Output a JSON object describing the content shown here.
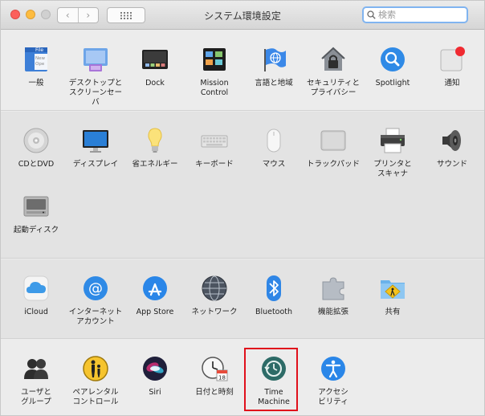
{
  "window": {
    "title": "システム環境設定"
  },
  "toolbar": {
    "back": "‹",
    "forward": "›"
  },
  "search": {
    "placeholder": "検索"
  },
  "sections": [
    [
      {
        "name": "general",
        "label": "一般",
        "icon": "general-icon"
      },
      {
        "name": "desktop-screensaver",
        "label": "デスクトップと\nスクリーンセーバ",
        "icon": "desktop-icon"
      },
      {
        "name": "dock",
        "label": "Dock",
        "icon": "dock-icon"
      },
      {
        "name": "mission-control",
        "label": "Mission\nControl",
        "icon": "mission-control-icon"
      },
      {
        "name": "language-region",
        "label": "言語と地域",
        "icon": "flag-globe-icon"
      },
      {
        "name": "security-privacy",
        "label": "セキュリティと\nプライバシー",
        "icon": "house-lock-icon"
      },
      {
        "name": "spotlight",
        "label": "Spotlight",
        "icon": "magnifier-icon"
      },
      {
        "name": "notifications",
        "label": "通知",
        "icon": "notifications-icon"
      }
    ],
    [
      {
        "name": "cd-dvd",
        "label": "CDとDVD",
        "icon": "disc-icon"
      },
      {
        "name": "displays",
        "label": "ディスプレイ",
        "icon": "monitor-icon"
      },
      {
        "name": "energy-saver",
        "label": "省エネルギー",
        "icon": "lightbulb-icon"
      },
      {
        "name": "keyboard",
        "label": "キーボード",
        "icon": "keyboard-icon"
      },
      {
        "name": "mouse",
        "label": "マウス",
        "icon": "mouse-icon"
      },
      {
        "name": "trackpad",
        "label": "トラックパッド",
        "icon": "trackpad-icon"
      },
      {
        "name": "printers-scanners",
        "label": "プリンタと\nスキャナ",
        "icon": "printer-icon"
      },
      {
        "name": "sound",
        "label": "サウンド",
        "icon": "speaker-icon"
      },
      {
        "name": "startup-disk",
        "label": "起動ディスク",
        "icon": "hard-drive-icon"
      }
    ],
    [
      {
        "name": "icloud",
        "label": "iCloud",
        "icon": "cloud-icon"
      },
      {
        "name": "internet-accounts",
        "label": "インターネット\nアカウント",
        "icon": "at-sign-icon"
      },
      {
        "name": "app-store",
        "label": "App Store",
        "icon": "app-store-icon"
      },
      {
        "name": "network",
        "label": "ネットワーク",
        "icon": "globe-icon"
      },
      {
        "name": "bluetooth",
        "label": "Bluetooth",
        "icon": "bluetooth-icon"
      },
      {
        "name": "extensions",
        "label": "機能拡張",
        "icon": "puzzle-icon"
      },
      {
        "name": "sharing",
        "label": "共有",
        "icon": "shared-folder-icon"
      }
    ],
    [
      {
        "name": "users-groups",
        "label": "ユーザと\nグループ",
        "icon": "users-icon"
      },
      {
        "name": "parental-controls",
        "label": "ペアレンタル\nコントロール",
        "icon": "parental-icon"
      },
      {
        "name": "siri",
        "label": "Siri",
        "icon": "siri-icon"
      },
      {
        "name": "date-time",
        "label": "日付と時刻",
        "icon": "clock-calendar-icon"
      },
      {
        "name": "time-machine",
        "label": "Time\nMachine",
        "icon": "time-machine-icon"
      },
      {
        "name": "accessibility",
        "label": "アクセシ\nビリティ",
        "icon": "accessibility-icon"
      }
    ]
  ],
  "colors": {
    "highlight": "#e0101b",
    "search_focus": "#80b4f0"
  }
}
